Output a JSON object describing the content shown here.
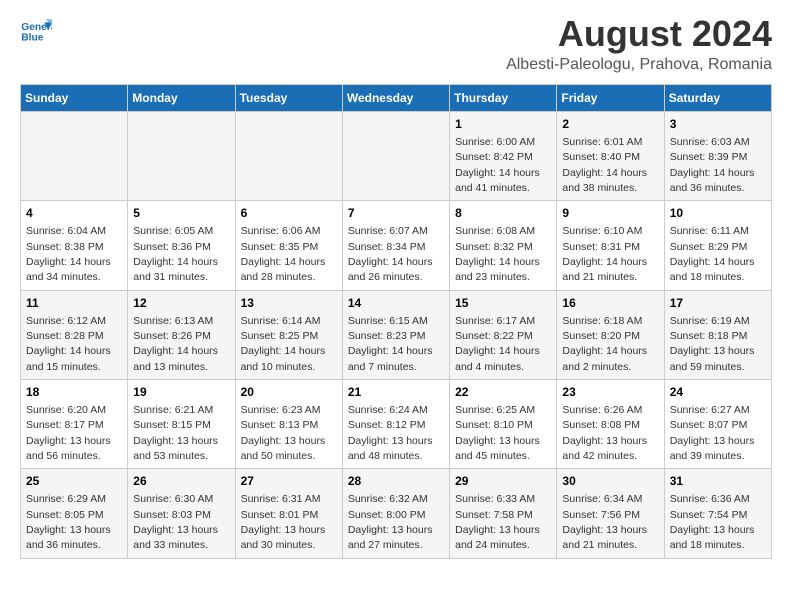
{
  "header": {
    "logo_line1": "General",
    "logo_line2": "Blue",
    "month_year": "August 2024",
    "location": "Albesti-Paleologu, Prahova, Romania"
  },
  "days_of_week": [
    "Sunday",
    "Monday",
    "Tuesday",
    "Wednesday",
    "Thursday",
    "Friday",
    "Saturday"
  ],
  "weeks": [
    [
      {
        "day": "",
        "info": ""
      },
      {
        "day": "",
        "info": ""
      },
      {
        "day": "",
        "info": ""
      },
      {
        "day": "",
        "info": ""
      },
      {
        "day": "1",
        "info": "Sunrise: 6:00 AM\nSunset: 8:42 PM\nDaylight: 14 hours and 41 minutes."
      },
      {
        "day": "2",
        "info": "Sunrise: 6:01 AM\nSunset: 8:40 PM\nDaylight: 14 hours and 38 minutes."
      },
      {
        "day": "3",
        "info": "Sunrise: 6:03 AM\nSunset: 8:39 PM\nDaylight: 14 hours and 36 minutes."
      }
    ],
    [
      {
        "day": "4",
        "info": "Sunrise: 6:04 AM\nSunset: 8:38 PM\nDaylight: 14 hours and 34 minutes."
      },
      {
        "day": "5",
        "info": "Sunrise: 6:05 AM\nSunset: 8:36 PM\nDaylight: 14 hours and 31 minutes."
      },
      {
        "day": "6",
        "info": "Sunrise: 6:06 AM\nSunset: 8:35 PM\nDaylight: 14 hours and 28 minutes."
      },
      {
        "day": "7",
        "info": "Sunrise: 6:07 AM\nSunset: 8:34 PM\nDaylight: 14 hours and 26 minutes."
      },
      {
        "day": "8",
        "info": "Sunrise: 6:08 AM\nSunset: 8:32 PM\nDaylight: 14 hours and 23 minutes."
      },
      {
        "day": "9",
        "info": "Sunrise: 6:10 AM\nSunset: 8:31 PM\nDaylight: 14 hours and 21 minutes."
      },
      {
        "day": "10",
        "info": "Sunrise: 6:11 AM\nSunset: 8:29 PM\nDaylight: 14 hours and 18 minutes."
      }
    ],
    [
      {
        "day": "11",
        "info": "Sunrise: 6:12 AM\nSunset: 8:28 PM\nDaylight: 14 hours and 15 minutes."
      },
      {
        "day": "12",
        "info": "Sunrise: 6:13 AM\nSunset: 8:26 PM\nDaylight: 14 hours and 13 minutes."
      },
      {
        "day": "13",
        "info": "Sunrise: 6:14 AM\nSunset: 8:25 PM\nDaylight: 14 hours and 10 minutes."
      },
      {
        "day": "14",
        "info": "Sunrise: 6:15 AM\nSunset: 8:23 PM\nDaylight: 14 hours and 7 minutes."
      },
      {
        "day": "15",
        "info": "Sunrise: 6:17 AM\nSunset: 8:22 PM\nDaylight: 14 hours and 4 minutes."
      },
      {
        "day": "16",
        "info": "Sunrise: 6:18 AM\nSunset: 8:20 PM\nDaylight: 14 hours and 2 minutes."
      },
      {
        "day": "17",
        "info": "Sunrise: 6:19 AM\nSunset: 8:18 PM\nDaylight: 13 hours and 59 minutes."
      }
    ],
    [
      {
        "day": "18",
        "info": "Sunrise: 6:20 AM\nSunset: 8:17 PM\nDaylight: 13 hours and 56 minutes."
      },
      {
        "day": "19",
        "info": "Sunrise: 6:21 AM\nSunset: 8:15 PM\nDaylight: 13 hours and 53 minutes."
      },
      {
        "day": "20",
        "info": "Sunrise: 6:23 AM\nSunset: 8:13 PM\nDaylight: 13 hours and 50 minutes."
      },
      {
        "day": "21",
        "info": "Sunrise: 6:24 AM\nSunset: 8:12 PM\nDaylight: 13 hours and 48 minutes."
      },
      {
        "day": "22",
        "info": "Sunrise: 6:25 AM\nSunset: 8:10 PM\nDaylight: 13 hours and 45 minutes."
      },
      {
        "day": "23",
        "info": "Sunrise: 6:26 AM\nSunset: 8:08 PM\nDaylight: 13 hours and 42 minutes."
      },
      {
        "day": "24",
        "info": "Sunrise: 6:27 AM\nSunset: 8:07 PM\nDaylight: 13 hours and 39 minutes."
      }
    ],
    [
      {
        "day": "25",
        "info": "Sunrise: 6:29 AM\nSunset: 8:05 PM\nDaylight: 13 hours and 36 minutes."
      },
      {
        "day": "26",
        "info": "Sunrise: 6:30 AM\nSunset: 8:03 PM\nDaylight: 13 hours and 33 minutes."
      },
      {
        "day": "27",
        "info": "Sunrise: 6:31 AM\nSunset: 8:01 PM\nDaylight: 13 hours and 30 minutes."
      },
      {
        "day": "28",
        "info": "Sunrise: 6:32 AM\nSunset: 8:00 PM\nDaylight: 13 hours and 27 minutes."
      },
      {
        "day": "29",
        "info": "Sunrise: 6:33 AM\nSunset: 7:58 PM\nDaylight: 13 hours and 24 minutes."
      },
      {
        "day": "30",
        "info": "Sunrise: 6:34 AM\nSunset: 7:56 PM\nDaylight: 13 hours and 21 minutes."
      },
      {
        "day": "31",
        "info": "Sunrise: 6:36 AM\nSunset: 7:54 PM\nDaylight: 13 hours and 18 minutes."
      }
    ]
  ]
}
